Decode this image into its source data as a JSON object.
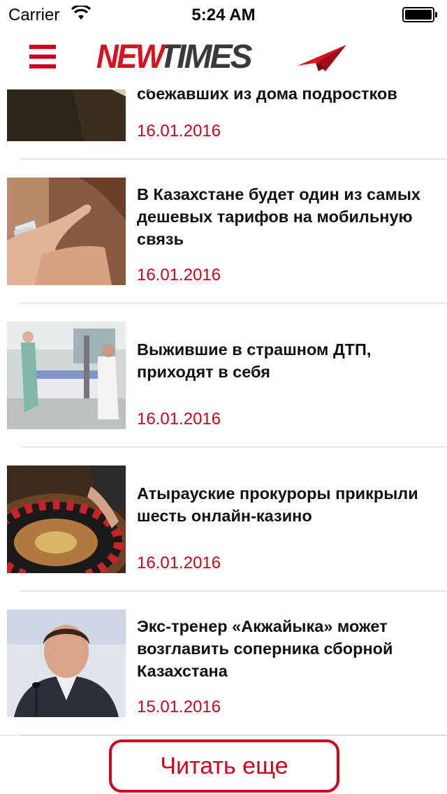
{
  "status_bar": {
    "carrier": "Carrier",
    "time": "5:24 AM"
  },
  "header": {
    "logo_part1": "NEW",
    "logo_part2": "TIMES"
  },
  "colors": {
    "accent": "#d0021b",
    "logo_dark": "#3a3a3a",
    "separator": "#d4d4d4"
  },
  "articles": [
    {
      "title": "сбежавших из дома подростков",
      "date": "16.01.2016",
      "thumbnail": "silhouette-hands"
    },
    {
      "title": "В Казахстане будет один из самых дешевых тарифов на мобильную связь",
      "date": "16.01.2016",
      "thumbnail": "hand-with-phone"
    },
    {
      "title": "Выжившие в страшном ДТП, приходят в себя",
      "date": "16.01.2016",
      "thumbnail": "hospital-ward"
    },
    {
      "title": "Атырауские прокуроры прикрыли шесть онлайн-казино",
      "date": "16.01.2016",
      "thumbnail": "roulette-wheel"
    },
    {
      "title": "Экс-тренер «Акжайыка» может возглавить соперника сборной Казахстана",
      "date": "15.01.2016",
      "thumbnail": "man-at-microphone"
    }
  ],
  "footer": {
    "more_label": "Читать еще"
  }
}
